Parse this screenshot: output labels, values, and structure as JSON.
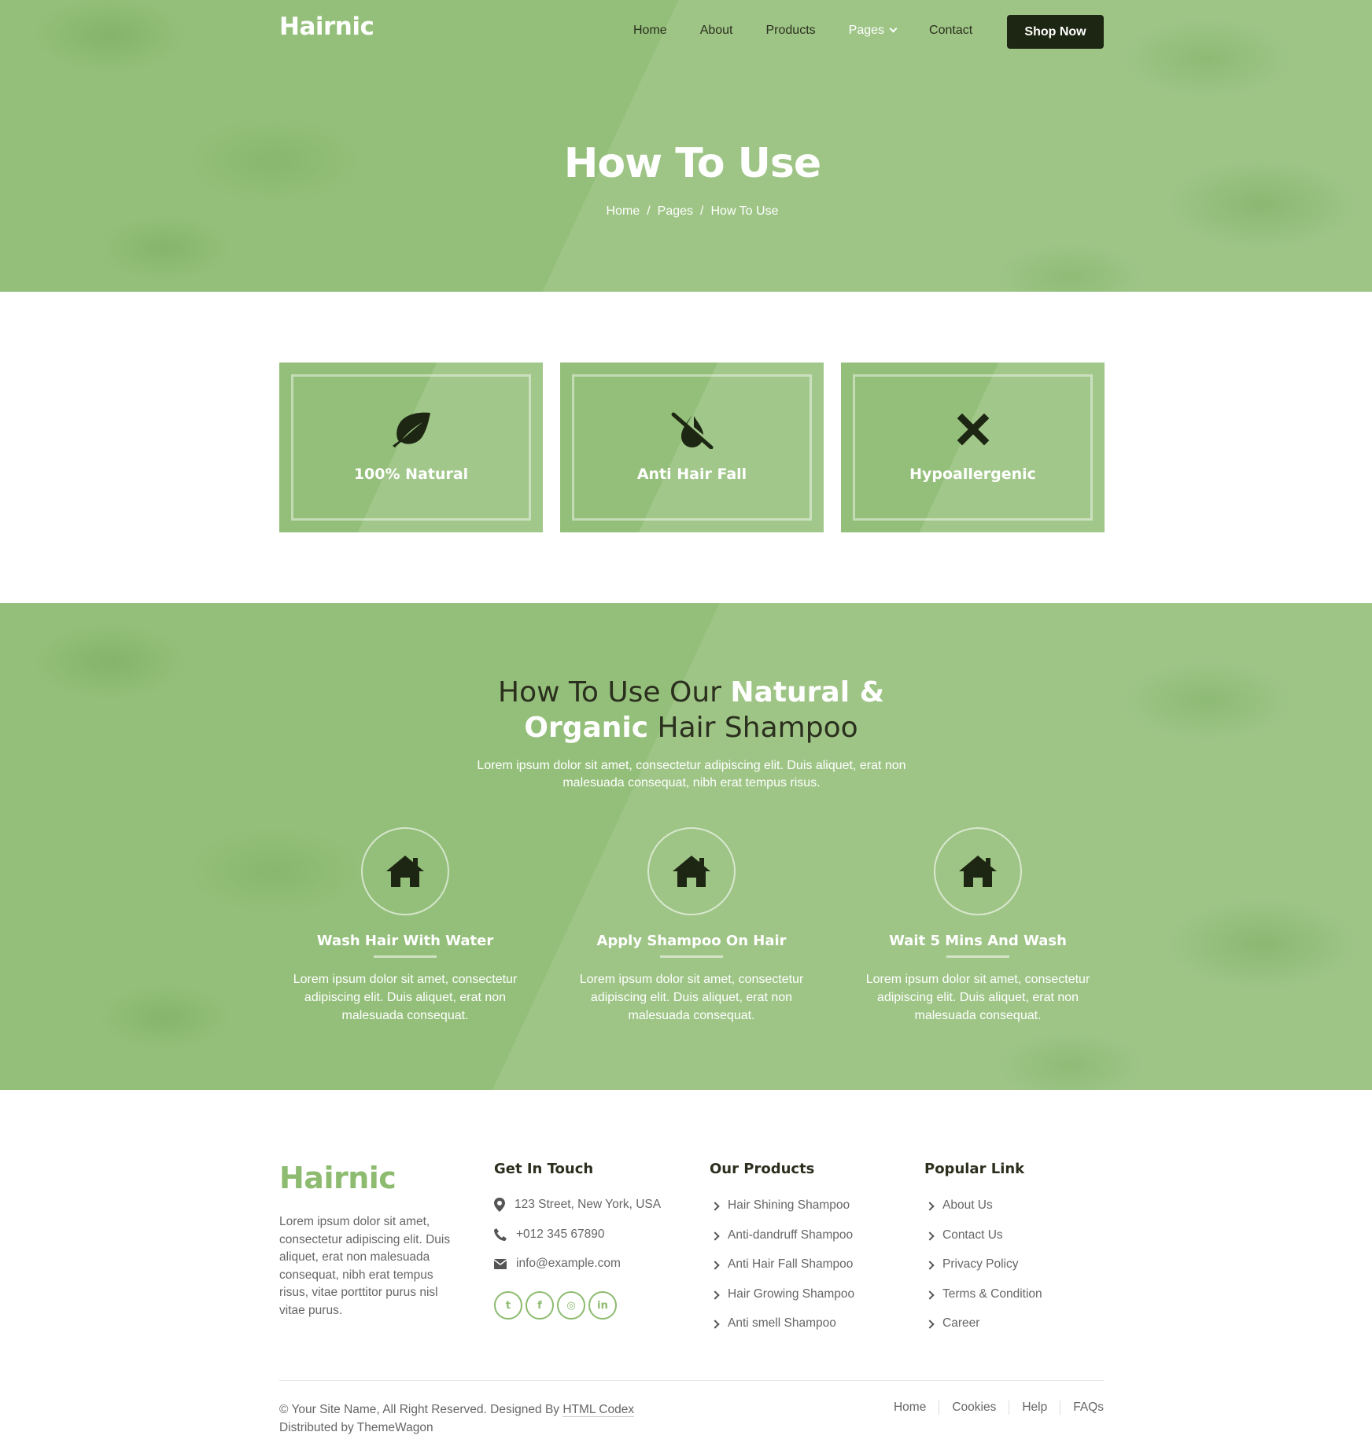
{
  "header": {
    "logo": "Hairnic",
    "nav": [
      "Home",
      "About",
      "Products",
      "Pages",
      "Contact"
    ],
    "cta": "Shop Now"
  },
  "hero": {
    "title": "How To Use",
    "breadcrumb": [
      "Home",
      "Pages",
      "How To Use"
    ]
  },
  "features": [
    {
      "label": "100% Natural",
      "icon": "leaf-icon"
    },
    {
      "label": "Anti Hair Fall",
      "icon": "drop-slash-icon"
    },
    {
      "label": "Hypoallergenic",
      "icon": "times-icon"
    }
  ],
  "howto": {
    "title_part1": "How To Use Our ",
    "title_bold1": "Natural &",
    "title_bold2": "Organic",
    "title_part2": " Hair Shampoo",
    "subtitle": "Lorem ipsum dolor sit amet, consectetur adipiscing elit. Duis aliquet, erat non malesuada consequat, nibh erat tempus risus.",
    "steps": [
      {
        "title": "Wash Hair With Water",
        "text": "Lorem ipsum dolor sit amet, consectetur adipiscing elit. Duis aliquet, erat non malesuada consequat.",
        "icon": "home-icon"
      },
      {
        "title": "Apply Shampoo On Hair",
        "text": "Lorem ipsum dolor sit amet, consectetur adipiscing elit. Duis aliquet, erat non malesuada consequat.",
        "icon": "home-icon"
      },
      {
        "title": "Wait 5 Mins And Wash",
        "text": "Lorem ipsum dolor sit amet, consectetur adipiscing elit. Duis aliquet, erat non malesuada consequat.",
        "icon": "home-icon"
      }
    ]
  },
  "footer": {
    "logo": "Hairnic",
    "about": "Lorem ipsum dolor sit amet, consectetur adipiscing elit. Duis aliquet, erat non malesuada consequat, nibh erat tempus risus, vitae porttitor purus nisl vitae purus.",
    "contact_title": "Get In Touch",
    "address": "123 Street, New York, USA",
    "phone": "+012 345 67890",
    "email": "info@example.com",
    "social": [
      "twitter-icon",
      "facebook-icon",
      "instagram-icon",
      "linkedin-icon"
    ],
    "products_title": "Our Products",
    "products": [
      "Hair Shining Shampoo",
      "Anti-dandruff Shampoo",
      "Anti Hair Fall Shampoo",
      "Hair Growing Shampoo",
      "Anti smell Shampoo"
    ],
    "links_title": "Popular Link",
    "links": [
      "About Us",
      "Contact Us",
      "Privacy Policy",
      "Terms & Condition",
      "Career"
    ],
    "copyright": "© Your Site Name, All Right Reserved. Designed By",
    "designer": "HTML Codex",
    "distributed": "Distributed by ThemeWagon",
    "bottom_links": [
      "Home",
      "Cookies",
      "Help",
      "FAQs"
    ]
  },
  "colors": {
    "brand": "#8dbb6f",
    "green_bg": "#94bf7a",
    "dark": "#1d2612"
  }
}
